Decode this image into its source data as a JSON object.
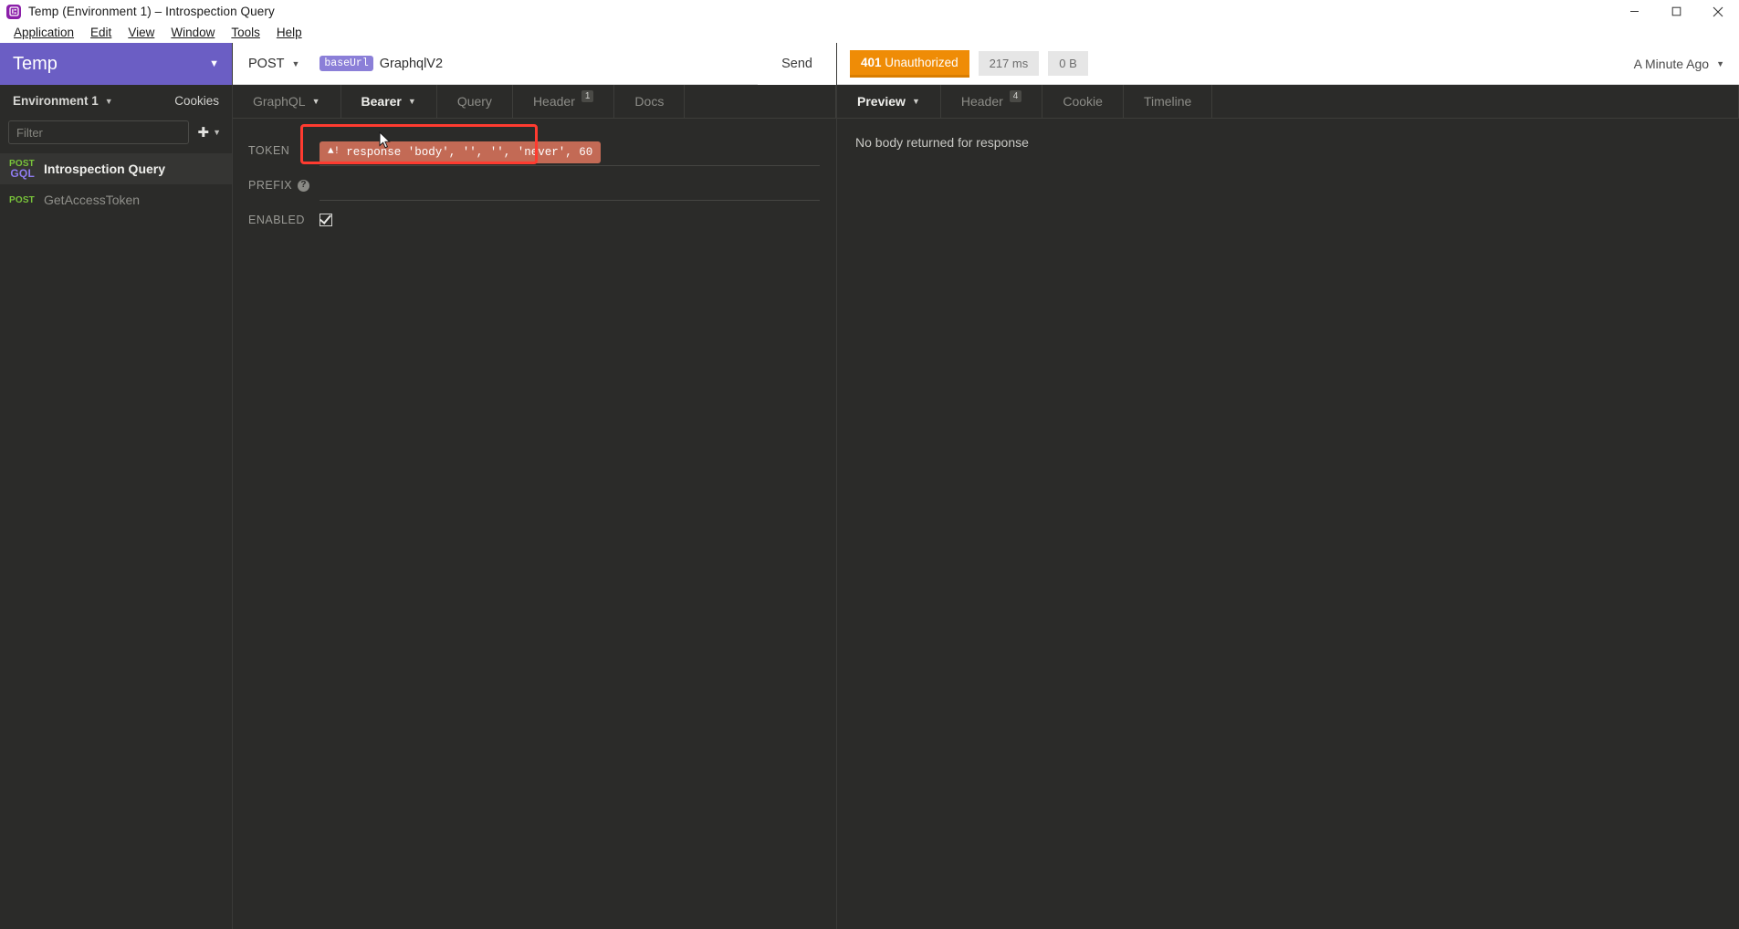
{
  "window": {
    "title": "Temp (Environment 1) – Introspection Query",
    "app_icon": "insomnia-logo-icon",
    "controls": {
      "minimize": "minimize-icon",
      "maximize": "maximize-icon",
      "close": "close-icon"
    }
  },
  "menubar": {
    "items": [
      {
        "label": "Application",
        "accel": "A"
      },
      {
        "label": "Edit",
        "accel": "E"
      },
      {
        "label": "View",
        "accel": "V"
      },
      {
        "label": "Window",
        "accel": "W"
      },
      {
        "label": "Tools",
        "accel": "T"
      },
      {
        "label": "Help",
        "accel": "H"
      }
    ]
  },
  "sidebar": {
    "workspace_name": "Temp",
    "workspace_caret": "chevron-down-icon",
    "environment": {
      "label": "Environment 1",
      "caret": "chevron-down-icon"
    },
    "cookies_label": "Cookies",
    "filter": {
      "value": "",
      "placeholder": "Filter"
    },
    "add_button": {
      "icon": "plus-circle-icon",
      "caret": "chevron-down-icon"
    },
    "requests": [
      {
        "method": "POST",
        "protocol": "GQL",
        "name": "Introspection Query",
        "active": true
      },
      {
        "method": "POST",
        "protocol": "",
        "name": "GetAccessToken",
        "active": false
      }
    ]
  },
  "request": {
    "method": "POST",
    "method_caret": "chevron-down-icon",
    "url_variable": "baseUrl",
    "url_path": "GraphqlV2",
    "send_label": "Send",
    "tabs": [
      {
        "label": "GraphQL",
        "caret": true,
        "badge": "",
        "active": false
      },
      {
        "label": "Bearer",
        "caret": true,
        "badge": "",
        "active": true
      },
      {
        "label": "Query",
        "caret": false,
        "badge": "",
        "active": false
      },
      {
        "label": "Header",
        "caret": false,
        "badge": "1",
        "active": false
      },
      {
        "label": "Docs",
        "caret": false,
        "badge": "",
        "active": false
      }
    ],
    "auth": {
      "token_label": "TOKEN",
      "token_value": "response 'body', '', '', 'never', 60",
      "token_warning_icon": "warning-triangle-icon",
      "prefix_label": "PREFIX",
      "prefix_help_icon": "help-circle-icon",
      "prefix_value": "",
      "enabled_label": "ENABLED",
      "enabled_checked": true
    }
  },
  "response": {
    "status": {
      "code": "401",
      "text": " Unauthorized"
    },
    "time": "217 ms",
    "size": "0 B",
    "history": {
      "label": "A Minute Ago",
      "caret": "chevron-down-icon"
    },
    "tabs": [
      {
        "label": "Preview",
        "caret": true,
        "badge": "",
        "active": true
      },
      {
        "label": "Header",
        "caret": false,
        "badge": "4",
        "active": false
      },
      {
        "label": "Cookie",
        "caret": false,
        "badge": "",
        "active": false
      },
      {
        "label": "Timeline",
        "caret": false,
        "badge": "",
        "active": false
      }
    ],
    "body_message": "No body returned for response"
  },
  "colors": {
    "accent_purple": "#6b5ec4",
    "status_orange": "#ef8c06",
    "error_red": "#ff3b30",
    "token_chip": "#c36a55",
    "method_green": "#78c23a",
    "gql_purple": "#8f7cf0"
  }
}
